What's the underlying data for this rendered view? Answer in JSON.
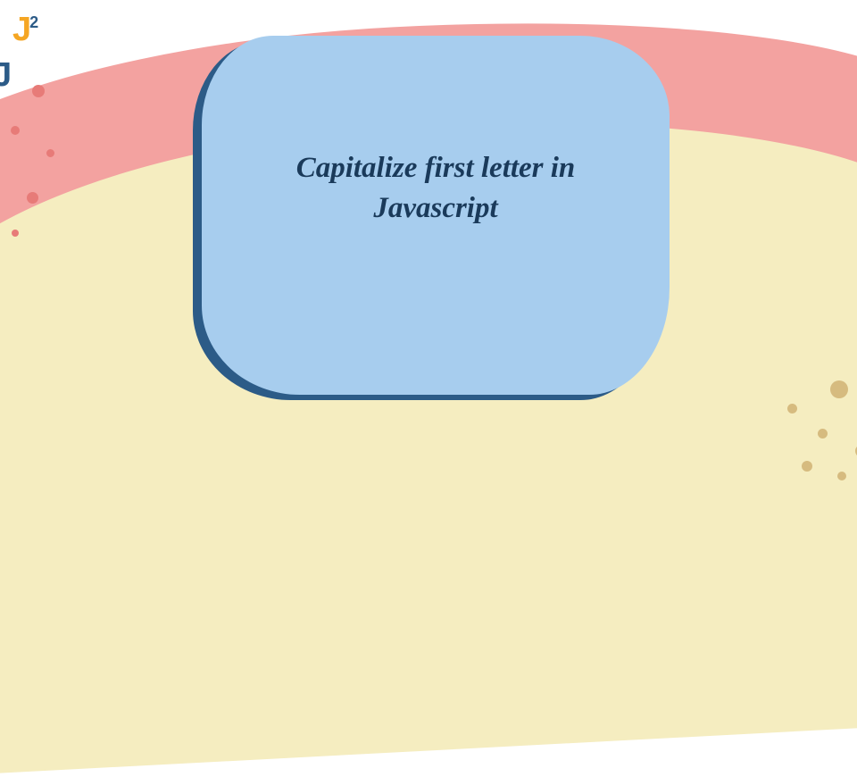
{
  "logo": {
    "letter1": "J",
    "superscript": "2",
    "letter2": "J"
  },
  "card": {
    "title": "Capitalize first letter in Javascript"
  },
  "colors": {
    "cardBg": "#a7cdee",
    "cardShadow": "#2c5b87",
    "bgYellow": "#f5edc0",
    "bgPink": "#f3a2a0",
    "dotsPink": "#e77b78",
    "dotsTan": "#d6bb7f",
    "titleText": "#1a3a5a"
  }
}
